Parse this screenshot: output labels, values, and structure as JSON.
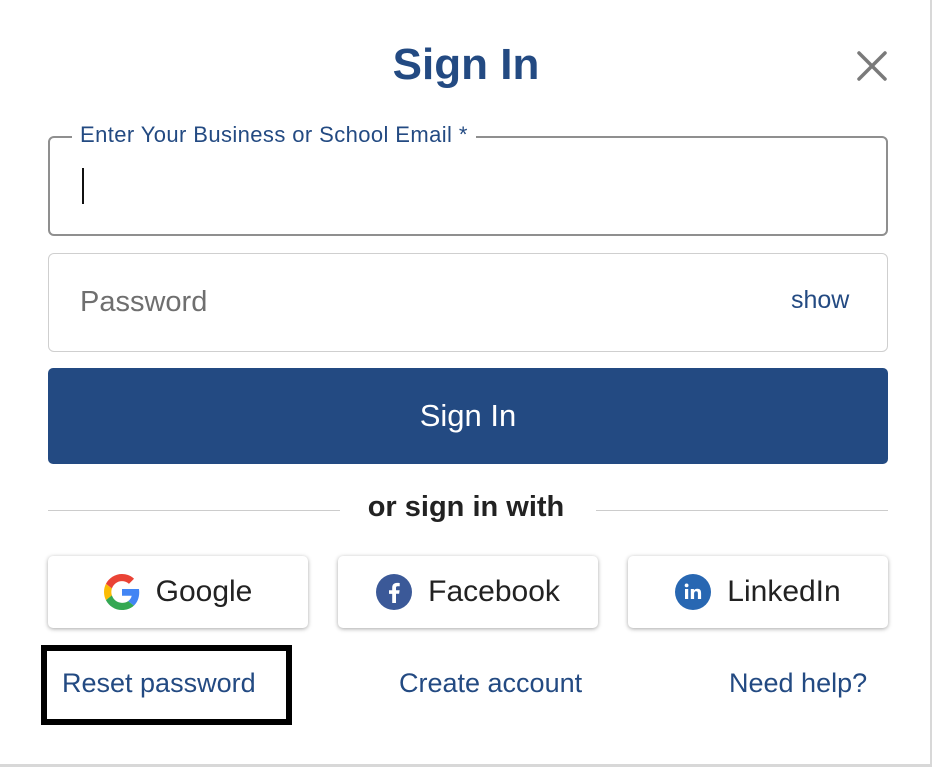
{
  "dialog": {
    "title": "Sign In",
    "close_icon": "close-icon"
  },
  "email": {
    "label": "Enter Your Business or School Email",
    "required_marker": "*",
    "value": ""
  },
  "password": {
    "placeholder": "Password",
    "show_label": "show"
  },
  "submit": {
    "label": "Sign In"
  },
  "divider": {
    "label": "or sign in with"
  },
  "social": [
    {
      "label": "Google",
      "icon": "google-icon"
    },
    {
      "label": "Facebook",
      "icon": "facebook-icon"
    },
    {
      "label": "LinkedIn",
      "icon": "linkedin-icon"
    }
  ],
  "links": {
    "reset": "Reset password",
    "create": "Create account",
    "help": "Need help?"
  },
  "colors": {
    "brand": "#234a82",
    "facebook": "#3b5998",
    "linkedin": "#2867b2"
  }
}
